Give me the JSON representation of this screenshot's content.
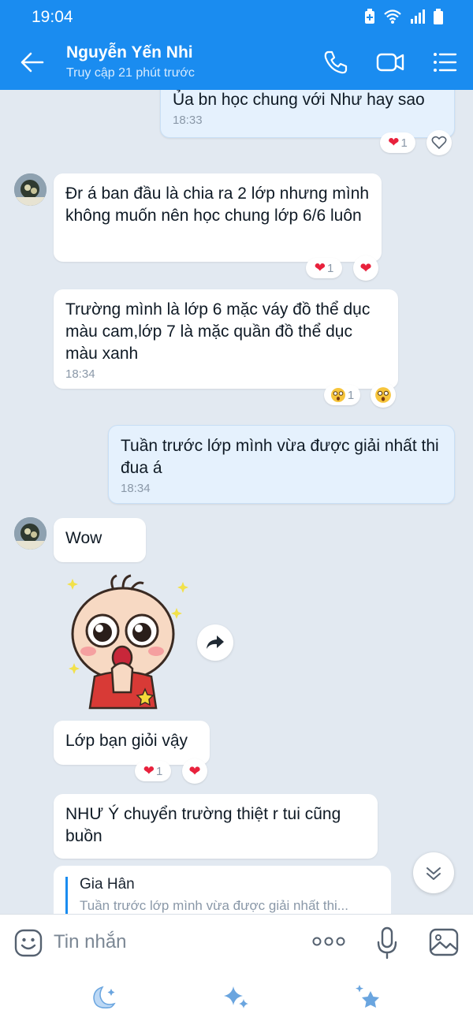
{
  "status_bar": {
    "time": "19:04"
  },
  "header": {
    "contact_name": "Nguyễn Yến Nhi",
    "last_seen": "Truy cập 21 phút trước"
  },
  "messages": {
    "m1": {
      "text": "Ủa bn học chung với Như hay sao",
      "time": "18:33",
      "reaction_count": "1"
    },
    "m2": {
      "text": "Đr á ban đầu là chia ra 2 lớp nhưng mình không muốn nên học chung lớp 6/6 luôn",
      "reaction_count": "1"
    },
    "m3": {
      "text": "Trường mình là lớp 6 mặc váy đồ thể dục màu cam,lớp 7 là mặc quần đồ thể dục màu xanh",
      "time": "18:34",
      "reaction_count": "1"
    },
    "m4": {
      "text": "Tuần trước lớp mình vừa được giải nhất thi đua á",
      "time": "18:34"
    },
    "m5": {
      "text": "Wow"
    },
    "m6": {
      "text": "Lớp bạn giỏi vậy",
      "reaction_count": "1"
    },
    "m7": {
      "text": "NHƯ Ý chuyển trường thiệt r tui cũng buồn"
    },
    "reply": {
      "name": "Gia Hân",
      "text": "Tuần trước lớp mình vừa được giải nhất thi..."
    }
  },
  "composer": {
    "placeholder": "Tin nhắn"
  },
  "colors": {
    "brand": "#1a8cf0",
    "heart": "#e8213c",
    "chat_bg": "#e2e9f1",
    "outgoing_bubble": "#e5f1fd"
  },
  "icons": [
    "back-arrow-icon",
    "phone-icon",
    "video-call-icon",
    "menu-list-icon",
    "heart-icon",
    "heart-outline-icon",
    "wow-emoji-icon",
    "forward-icon",
    "chevron-down-icon",
    "emoji-icon",
    "more-dots-icon",
    "microphone-icon",
    "image-icon",
    "moon-icon",
    "sparkle-icon",
    "star-icon"
  ]
}
